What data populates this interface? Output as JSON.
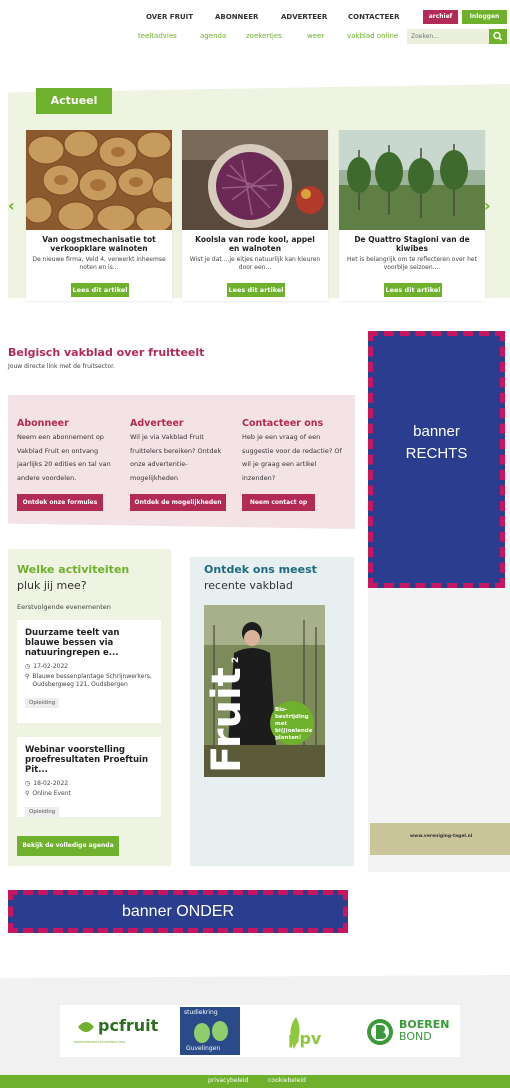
{
  "nav": {
    "top": [
      "OVER FRUIT",
      "ABONNEER",
      "ADVERTEER",
      "CONTACTEER"
    ],
    "sub": [
      "teeltadvies",
      "agenda",
      "zoekertjes",
      "weer",
      "vakblad online"
    ],
    "archief": "archief",
    "login": "Inloggen",
    "search_placeholder": "Zoeken..."
  },
  "actueel": {
    "title": "Actueel",
    "cards": [
      {
        "title": "Van oogstmechanisatie tot verkoopklare walnoten",
        "excerpt": "De nieuwe firma, Veld 4, verwerkt inheemse noten en is...",
        "button": "Lees dit artikel"
      },
      {
        "title": "Koolsla van rode kool, appel en walnoten",
        "excerpt": "Wist je dat....je eitjes natuurlijk kan kleuren door een...",
        "button": "Lees dit artikel"
      },
      {
        "title": "De Quattro Stagioni van de kiwibes",
        "excerpt": "Het is belangrijk om te reflecteren over het voorbije seizoen....",
        "button": "Lees dit artikel"
      }
    ]
  },
  "intro": {
    "title": "Belgisch vakblad over fruitteelt",
    "subtitle": "Jouw directe link met de fruitsector."
  },
  "ctas": [
    {
      "title": "Abonneer",
      "text": "Neem een abonnement op Vakblad Fruit en ontvang jaarlijks 20 edities en tal van andere voordelen.",
      "button": "Ontdek onze formules"
    },
    {
      "title": "Adverteer",
      "text": "Wil je via Vakblad Fruit fruittelers bereiken? Ontdek onze advertentie-mogelijkheden",
      "button": "Ontdek de mogelijkheden"
    },
    {
      "title": "Contacteer ons",
      "text": "Heb je een vraag of een suggestie voor de redactie? Of wil je graag een artikel inzenden?",
      "button": "Neem contact op"
    }
  ],
  "activities": {
    "title_bold": "Welke activiteiten",
    "title_rest": "pluk jij mee?",
    "subtitle": "Eerstvolgende evenementen",
    "events": [
      {
        "title": "Duurzame teelt van blauwe bessen via natuuringrepen e...",
        "date": "17-02-2022",
        "location": "Blauwe bessenplantage Schrijnwerkers, Oudsbergweg 121, Oudsbergen",
        "tag": "Opleiding"
      },
      {
        "title": "Webinar voorstelling proefresultaten Proeftuin Pit...",
        "date": "18-02-2022",
        "location": "Online Event",
        "tag": "Opleiding"
      }
    ],
    "button": "Bekijk de volledige agenda"
  },
  "magazine": {
    "title_bold": "Ontdek ons meest",
    "title_rest": "recente vakblad",
    "cover_headline": "Bio-bestrijding met bi(j)oelende planten!",
    "cover_logo": "Fruit",
    "cover_issue": "2"
  },
  "banners": {
    "right": [
      "banner",
      "RECHTS"
    ],
    "bottom": "banner ONDER"
  },
  "side_ad": {
    "url": "www.vereniging-tagel.nl"
  },
  "partners": [
    "pcfruit",
    "PROEFCENTRUM FRUITTEELT VZW",
    "studiekring",
    "Guvelingen",
    "ppv",
    "BOEREN",
    "BOND"
  ],
  "footer": [
    "privacybeleid",
    "cookiebeleid"
  ],
  "colors": {
    "green": "#6fb02c",
    "berry": "#b22a56",
    "banner_blue": "#2a3d8f",
    "banner_border": "#c9155f"
  }
}
